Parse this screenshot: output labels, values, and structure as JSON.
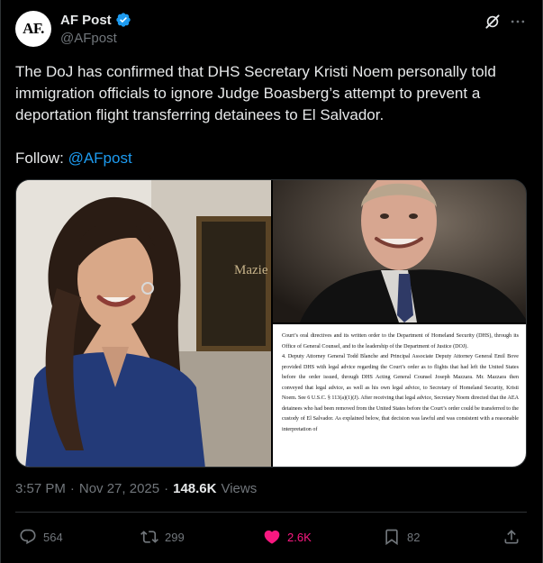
{
  "author": {
    "avatar_text": "AF.",
    "name": "AF Post",
    "handle": "@AFpost"
  },
  "tweet": {
    "text": "The DoJ has confirmed that DHS Secretary Kristi Noem personally told immigration officials to ignore Judge Boasberg’s attempt to prevent a deportation flight transferring detainees to El Salvador.",
    "follow_prefix": "Follow: ",
    "follow_mention": "@AFpost"
  },
  "media": {
    "left_sign_text": "Mazie",
    "document_text": "Court’s oral directives and its written order to the Department of Homeland Security (DHS), through its Office of General Counsel, and to the leadership of the Department of Justice (DOJ).\n4.      Deputy Attorney General Todd Blanche and Principal Associate Deputy Attorney General Emil Bove provided DHS with legal advice regarding the Court’s order as to flights that had left the United States before the order issued, through DHS Acting General Counsel Joseph Mazzara. Mr. Mazzara then conveyed that legal advice, as well as his own legal advice, to Secretary of Homeland Security, Kristi Noem. See 6 U.S.C. § 113(a)(1)(J). After receiving that legal advice, Secretary Noem directed that the AEA detainees who had been removed from the United States before the Court’s order could be transferred to the custody of El Salvador. As explained below, that decision was lawful and was consistent with a reasonable interpretation of"
  },
  "meta": {
    "time": "3:57 PM",
    "separator": "·",
    "date": "Nov 27, 2025",
    "views_count": "148.6K",
    "views_label": "Views"
  },
  "actions": {
    "replies": "564",
    "reposts": "299",
    "likes": "2.6K",
    "bookmarks": "82"
  },
  "colors": {
    "accent": "#1d9bf0",
    "like": "#f91880",
    "muted": "#71767b"
  }
}
